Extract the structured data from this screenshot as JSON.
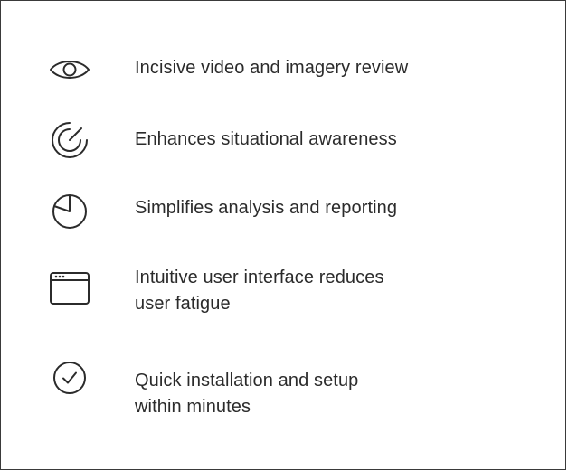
{
  "features": [
    {
      "icon": "eye-icon",
      "text": "Incisive video and imagery review"
    },
    {
      "icon": "radar-target-icon",
      "text": "Enhances situational awareness"
    },
    {
      "icon": "pie-chart-icon",
      "text": "Simplifies analysis and reporting"
    },
    {
      "icon": "browser-window-icon",
      "text": "Intuitive user interface reduces\nuser fatigue"
    },
    {
      "icon": "checkmark-circle-icon",
      "text": "Quick installation and setup\nwithin minutes"
    }
  ],
  "colors": {
    "text": "#2b2b2b",
    "icon_stroke": "#2b2b2b",
    "border": "#3a3a3a",
    "background": "#ffffff"
  }
}
